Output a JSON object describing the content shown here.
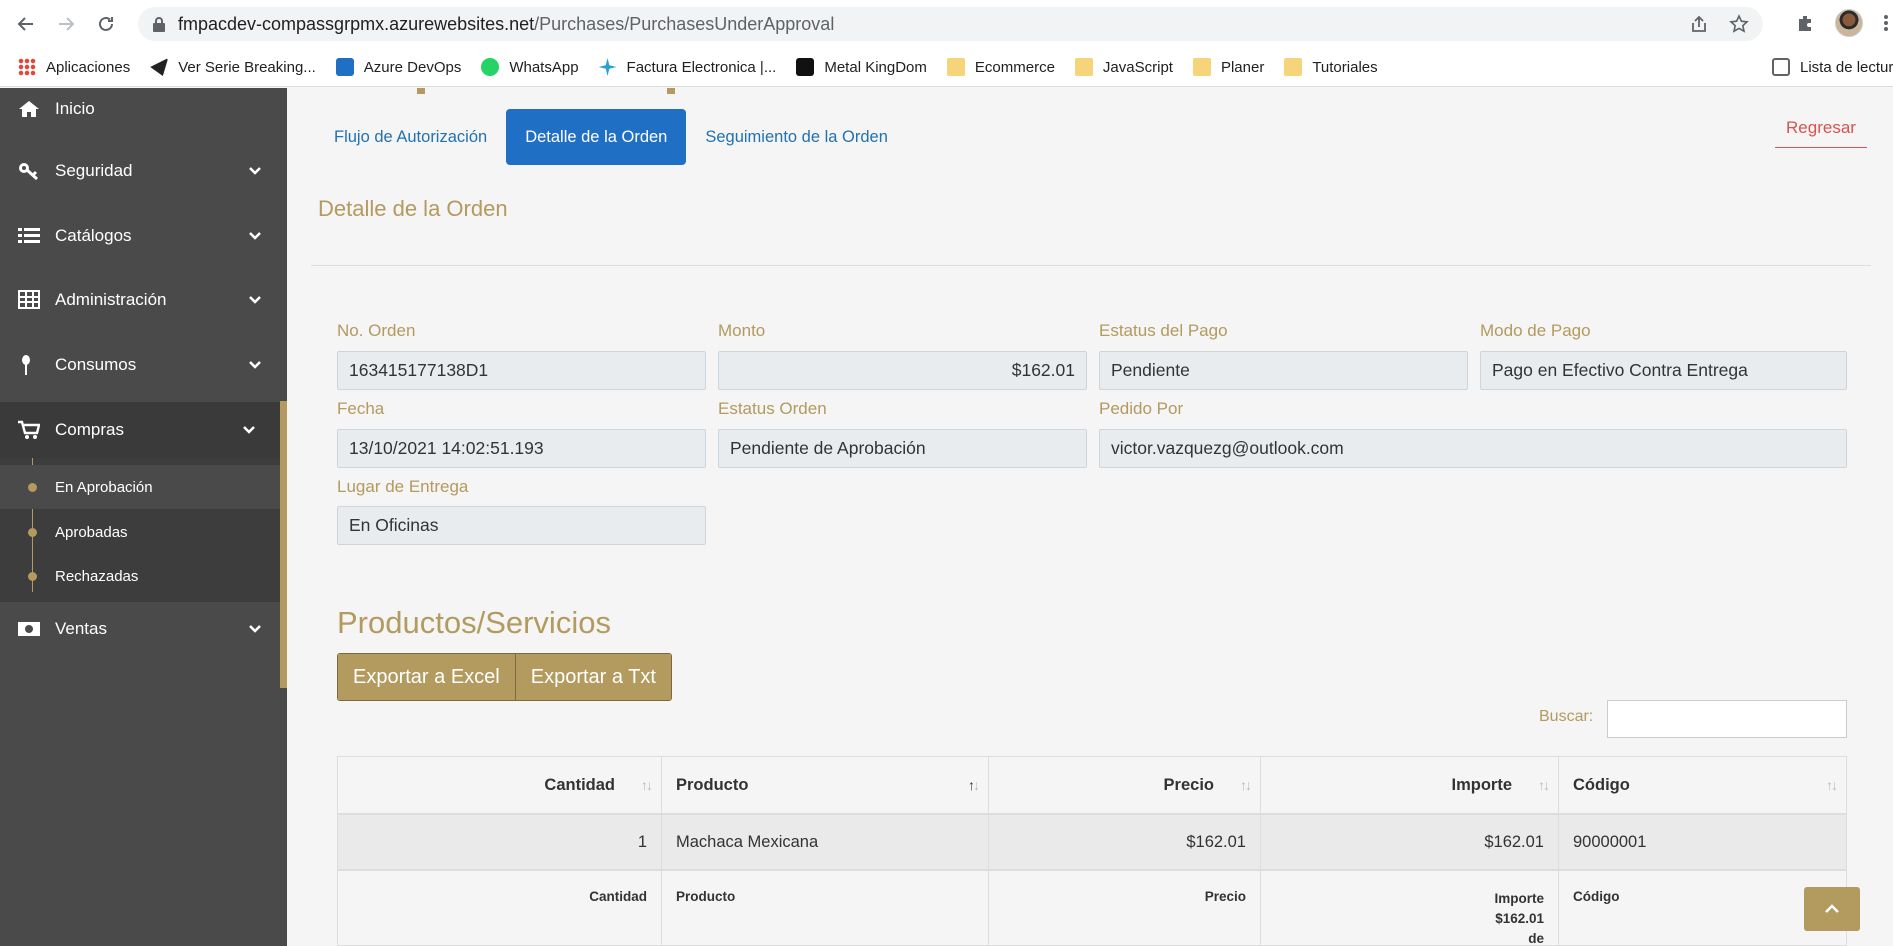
{
  "browser": {
    "url_host": "fmpacdev-compassgrpmx.azurewebsites.net",
    "url_path": "/Purchases/PurchasesUnderApproval",
    "bookmarks": [
      {
        "label": "Aplicaciones",
        "icon": "apps-grid-icon"
      },
      {
        "label": "Ver Serie Breaking...",
        "icon": "plane-icon"
      },
      {
        "label": "Azure DevOps",
        "icon": "azure-devops-icon"
      },
      {
        "label": "WhatsApp",
        "icon": "whatsapp-icon"
      },
      {
        "label": "Factura Electronica |...",
        "icon": "factura-icon"
      },
      {
        "label": "Metal KingDom",
        "icon": "metal-kingdom-icon"
      },
      {
        "label": "Ecommerce",
        "icon": "folder-icon"
      },
      {
        "label": "JavaScript",
        "icon": "folder-icon"
      },
      {
        "label": "Planer",
        "icon": "folder-icon"
      },
      {
        "label": "Tutoriales",
        "icon": "folder-icon"
      }
    ],
    "reading_list": "Lista de lectur"
  },
  "sidebar": {
    "items": [
      {
        "label": "Inicio",
        "icon": "home-icon"
      },
      {
        "label": "Seguridad",
        "icon": "key-icon"
      },
      {
        "label": "Catálogos",
        "icon": "list-icon"
      },
      {
        "label": "Administración",
        "icon": "table-icon"
      },
      {
        "label": "Consumos",
        "icon": "spoon-icon"
      },
      {
        "label": "Compras",
        "icon": "cart-icon"
      },
      {
        "label": "Ventas",
        "icon": "money-icon"
      }
    ],
    "compras_sub": [
      {
        "label": "En Aprobación"
      },
      {
        "label": "Aprobadas"
      },
      {
        "label": "Rechazadas"
      }
    ]
  },
  "tabs": [
    {
      "label": "Flujo de Autorización"
    },
    {
      "label": "Detalle de la Orden"
    },
    {
      "label": "Seguimiento de la Orden"
    }
  ],
  "back_label": "Regresar",
  "section_title": "Detalle de la Orden",
  "fields": {
    "no_orden": {
      "label": "No. Orden",
      "value": "163415177138D1"
    },
    "monto": {
      "label": "Monto",
      "value": "$162.01"
    },
    "estatus_pago": {
      "label": "Estatus del Pago",
      "value": "Pendiente"
    },
    "modo_pago": {
      "label": "Modo de Pago",
      "value": "Pago en Efectivo Contra Entrega"
    },
    "fecha": {
      "label": "Fecha",
      "value": "13/10/2021 14:02:51.193"
    },
    "estatus_orden": {
      "label": "Estatus Orden",
      "value": "Pendiente de Aprobación"
    },
    "pedido_por": {
      "label": "Pedido Por",
      "value": "victor.vazquezg@outlook.com"
    },
    "lugar_entrega": {
      "label": "Lugar de Entrega",
      "value": "En Oficinas"
    }
  },
  "products": {
    "title": "Productos/Servicios",
    "export_excel": "Exportar a Excel",
    "export_txt": "Exportar a Txt",
    "search_label": "Buscar:",
    "search_value": "",
    "columns": [
      "Cantidad",
      "Producto",
      "Precio",
      "Importe",
      "Código"
    ],
    "rows": [
      {
        "cantidad": "1",
        "producto": "Machaca Mexicana",
        "precio": "$162.01",
        "importe": "$162.01",
        "codigo": "90000001"
      }
    ],
    "footer": {
      "cantidad": "Cantidad",
      "producto": "Producto",
      "precio": "Precio",
      "importe_l1": "Importe",
      "importe_l2": "$162.01",
      "importe_l3": "de",
      "codigo": "Código"
    }
  }
}
